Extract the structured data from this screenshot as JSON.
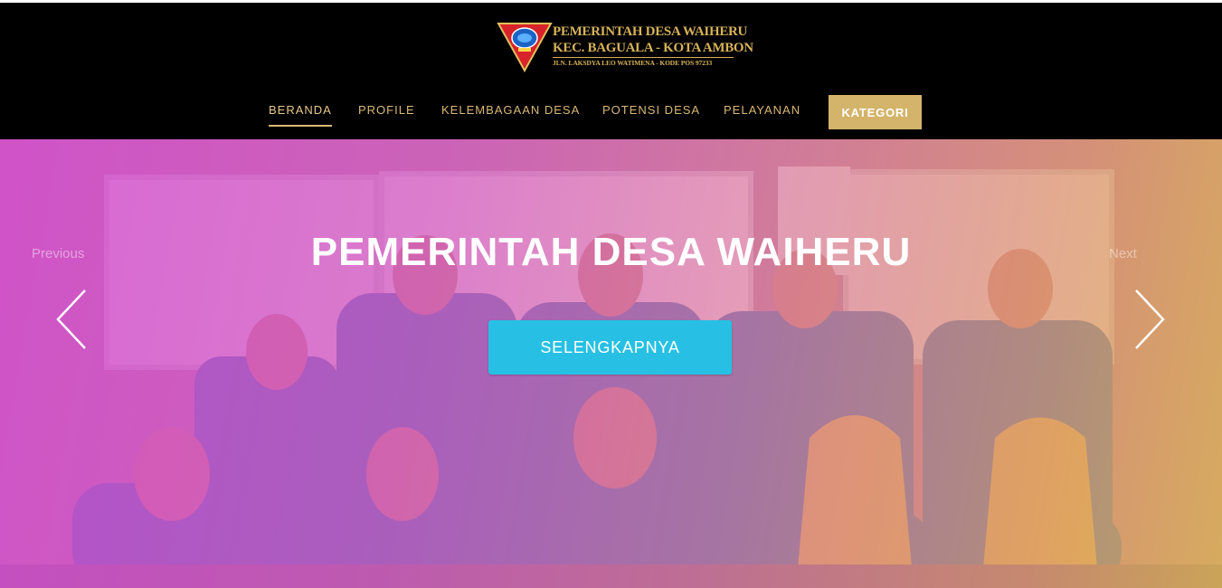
{
  "header": {
    "brand": {
      "line1": "PEMERINTAH DESA WAIHERU",
      "line2": "KEC. BAGUALA - KOTA AMBON",
      "line3": "JLN. LAKSDYA LEO WATIMENA - KODE POS 97233"
    },
    "nav": [
      {
        "label": "BERANDA",
        "active": true
      },
      {
        "label": "PROFILE"
      },
      {
        "label": "KELEMBAGAAN DESA"
      },
      {
        "label": "POTENSI DESA"
      },
      {
        "label": "PELAYANAN"
      }
    ],
    "cta_label": "KATEGORI"
  },
  "hero": {
    "title": "PEMERINTAH DESA WAIHERU",
    "button_label": "SELENGKAPNYA",
    "prev_label": "Previous",
    "next_label": "Next"
  },
  "colors": {
    "header_bg": "#000000",
    "gold": "#d9b774",
    "cta_bg": "#d4b46a",
    "hero_button": "#27c0e4"
  },
  "icons": {
    "logo": "shield-emblem-icon",
    "prev": "chevron-left-icon",
    "next": "chevron-right-icon"
  }
}
